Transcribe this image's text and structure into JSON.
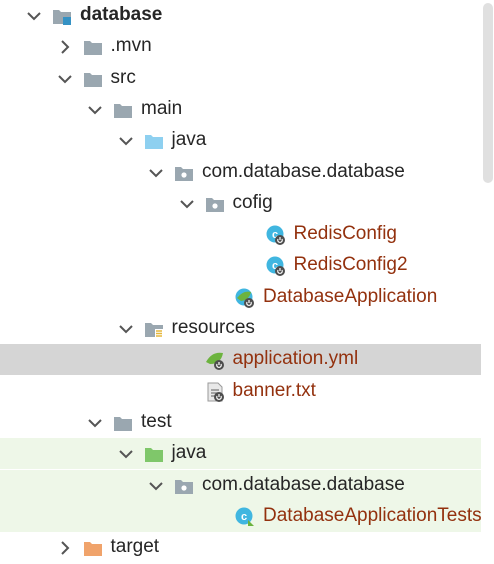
{
  "tree": [
    {
      "label": "database",
      "depth": 0,
      "arrow": "expanded",
      "icon": "module-folder-icon",
      "bold": true
    },
    {
      "label": ".mvn",
      "depth": 1,
      "arrow": "collapsed",
      "icon": "folder-icon"
    },
    {
      "label": "src",
      "depth": 1,
      "arrow": "expanded",
      "icon": "folder-icon"
    },
    {
      "label": "main",
      "depth": 2,
      "arrow": "expanded",
      "icon": "folder-icon"
    },
    {
      "label": "java",
      "depth": 3,
      "arrow": "expanded",
      "icon": "source-root-folder-icon"
    },
    {
      "label": "com.database.database",
      "depth": 4,
      "arrow": "expanded",
      "icon": "package-icon"
    },
    {
      "label": "cofig",
      "depth": 5,
      "arrow": "expanded",
      "icon": "package-icon"
    },
    {
      "label": "RedisConfig",
      "depth": 7,
      "arrow": "none",
      "icon": "java-class-icon",
      "source": true
    },
    {
      "label": "RedisConfig2",
      "depth": 7,
      "arrow": "none",
      "icon": "java-class-icon",
      "source": true
    },
    {
      "label": "DatabaseApplication",
      "depth": 6,
      "arrow": "none",
      "icon": "spring-boot-class-icon",
      "source": true
    },
    {
      "label": "resources",
      "depth": 3,
      "arrow": "expanded",
      "icon": "resources-folder-icon"
    },
    {
      "label": "application.yml",
      "depth": 5,
      "arrow": "none",
      "icon": "spring-yml-icon",
      "source": true,
      "selected": true
    },
    {
      "label": "banner.txt",
      "depth": 5,
      "arrow": "none",
      "icon": "text-file-icon",
      "source": true
    },
    {
      "label": "test",
      "depth": 2,
      "arrow": "expanded",
      "icon": "folder-icon"
    },
    {
      "label": "java",
      "depth": 3,
      "arrow": "expanded",
      "icon": "test-source-folder-icon",
      "test": true
    },
    {
      "label": "com.database.database",
      "depth": 4,
      "arrow": "expanded",
      "icon": "package-icon",
      "test": true
    },
    {
      "label": "DatabaseApplicationTests",
      "depth": 6,
      "arrow": "none",
      "icon": "java-test-class-icon",
      "source": true,
      "test": true
    },
    {
      "label": "target",
      "depth": 1,
      "arrow": "collapsed",
      "icon": "excluded-folder-icon"
    }
  ],
  "colors": {
    "selection": "#d5d5d5",
    "test_background": "#eef7e8",
    "source_text": "#93310e",
    "folder_gray": "#9aa7b0",
    "source_root_blue": "#8ed0f0",
    "test_green": "#7fc76a",
    "excluded_orange": "#f0a36b",
    "class_teal": "#40b6e0"
  }
}
